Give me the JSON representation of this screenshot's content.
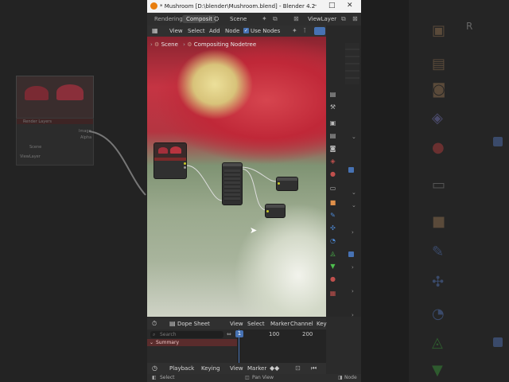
{
  "window": {
    "title": "* Mushroom [D:\\blender\\Mushroom.blend] - Blender 4.2",
    "controls": {
      "minimize": "–",
      "maximize": "□",
      "close": "✕"
    }
  },
  "topbar": {
    "tabs": [
      "Rendering",
      "Composit"
    ],
    "scene_label": "Scene",
    "view_layer": "ViewLayer"
  },
  "node_editor": {
    "menus": [
      "View",
      "Select",
      "Add",
      "Node"
    ],
    "use_nodes_label": "Use Nodes",
    "breadcrumb": [
      "Scene",
      "Compositing Nodetree"
    ]
  },
  "background_panel": {
    "node_title": "Render Layers",
    "sockets": [
      "Image",
      "Alpha"
    ],
    "scene_value": "Scene",
    "view_layer_value": "ViewLayer"
  },
  "dope_sheet": {
    "mode": "Dope Sheet",
    "menus": [
      "View",
      "Select",
      "Marker",
      "Channel",
      "Key"
    ],
    "search_placeholder": "Search",
    "summary_label": "Summary",
    "current_frame": "1",
    "frame_ticks": [
      "100",
      "200"
    ]
  },
  "timeline": {
    "menus": [
      "Playback",
      "Keying",
      "View",
      "Marker"
    ]
  },
  "statusbar": {
    "left": "Select",
    "middle": "Pan View",
    "right": "Node"
  },
  "right_side_letter": "R",
  "colors": {
    "accent": "#4772b3",
    "node_header_red": "#7a2a2a",
    "mushroom_red": "#c53443",
    "socket_yellow": "#c7c729"
  }
}
